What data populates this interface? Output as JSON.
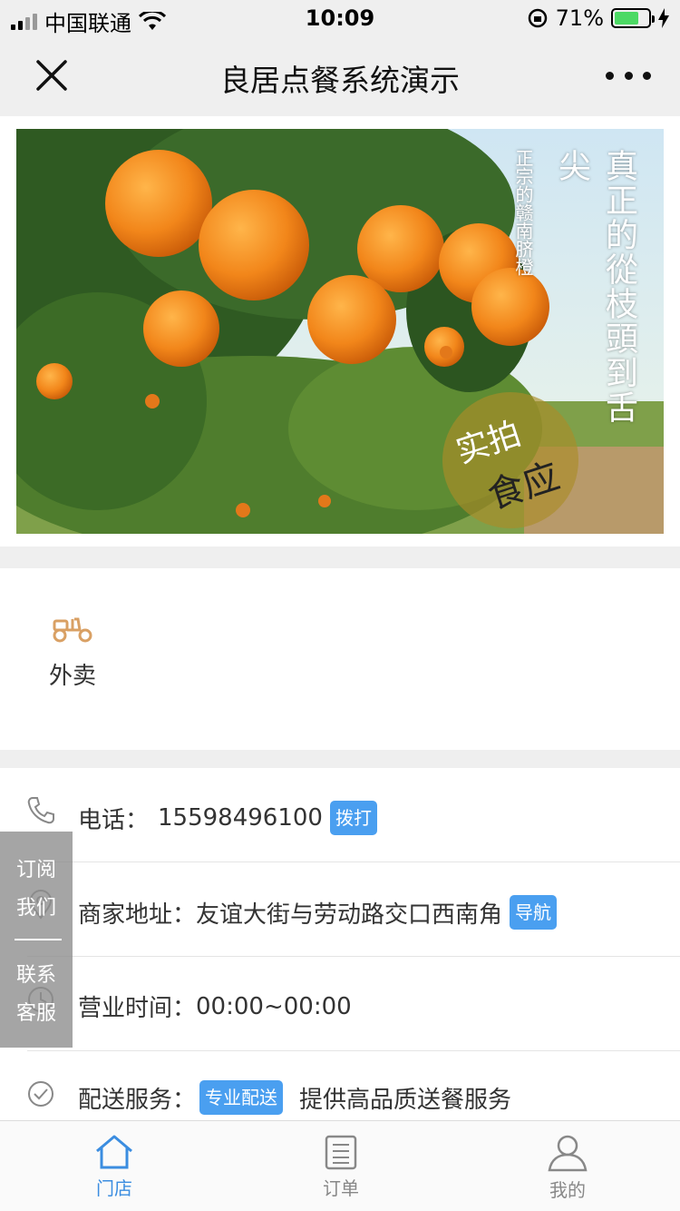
{
  "status_bar": {
    "carrier": "中国联通",
    "time": "10:09",
    "battery": "71%",
    "battery_level": 0.71
  },
  "nav": {
    "title": "良居点餐系统演示"
  },
  "banner": {
    "caption_main": "真正的從枝頭到舌尖",
    "caption_sub": "正宗的赣南脐橙",
    "stamp_top": "实拍",
    "stamp_bottom": "食应"
  },
  "service": {
    "items": [
      {
        "label": "外卖",
        "icon": "scooter-icon"
      }
    ]
  },
  "info": {
    "phone_label": "电话：",
    "phone_value": "15598496100",
    "phone_action": "拨打",
    "address_label": "商家地址：",
    "address_value": "友谊大街与劳动路交口西南角",
    "address_action": "导航",
    "hours_label": "营业时间：",
    "hours_value": "00:00~00:00",
    "delivery_label": "配送服务：",
    "delivery_tag": "专业配送",
    "delivery_value": "提供高品质送餐服务"
  },
  "float_panel": {
    "subscribe_line1": "订阅",
    "subscribe_line2": "我们",
    "contact_line1": "联系",
    "contact_line2": "客服"
  },
  "tabbar": {
    "items": [
      {
        "label": "门店",
        "icon": "home-icon",
        "active": true
      },
      {
        "label": "订单",
        "icon": "order-icon",
        "active": false
      },
      {
        "label": "我的",
        "icon": "user-icon",
        "active": false
      }
    ]
  },
  "colors": {
    "accent": "#4a9ff0",
    "tab_active": "#3b8de0",
    "service_icon": "#d9a064"
  }
}
